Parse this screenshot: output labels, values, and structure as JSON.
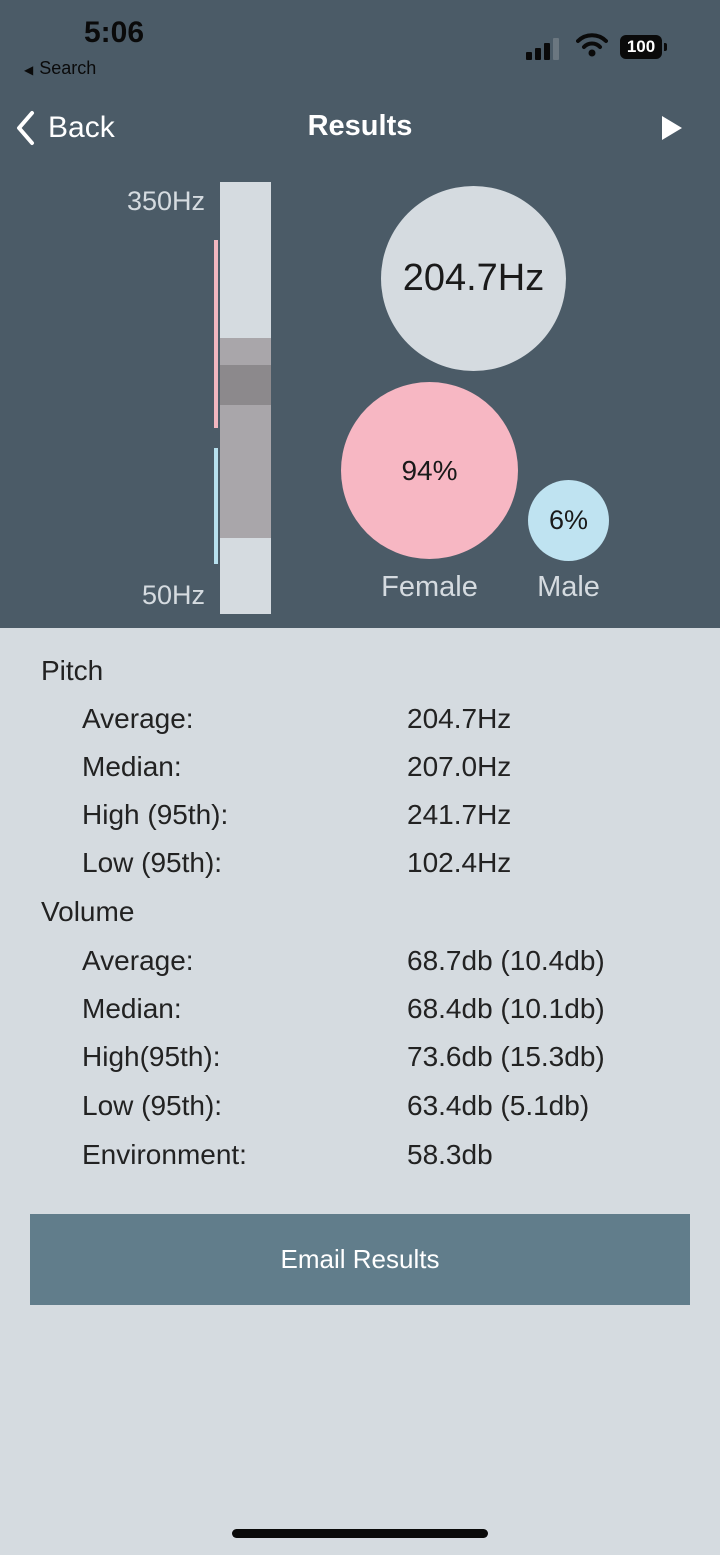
{
  "status_bar": {
    "time": "5:06",
    "back_app": "Search",
    "battery": "100"
  },
  "nav": {
    "back_label": "Back",
    "title": "Results"
  },
  "pitch_scale": {
    "max_label": "350Hz",
    "min_label": "50Hz"
  },
  "summary": {
    "average_pitch": "204.7Hz",
    "female_percent": "94%",
    "male_percent": "6%",
    "female_label": "Female",
    "male_label": "Male"
  },
  "pitch": {
    "heading": "Pitch",
    "rows": [
      {
        "label": "Average:",
        "value": "204.7Hz"
      },
      {
        "label": "Median:",
        "value": "207.0Hz"
      },
      {
        "label": "High (95th):",
        "value": "241.7Hz"
      },
      {
        "label": "Low (95th):",
        "value": "102.4Hz"
      }
    ]
  },
  "volume": {
    "heading": "Volume",
    "rows": [
      {
        "label": "Average:",
        "value": "68.7db (10.4db)"
      },
      {
        "label": "Median:",
        "value": "68.4db (10.1db)"
      },
      {
        "label": "High(95th):",
        "value": "73.6db (15.3db)"
      },
      {
        "label": "Low (95th):",
        "value": "63.4db (5.1db)"
      },
      {
        "label": "Environment:",
        "value": "58.3db"
      }
    ]
  },
  "actions": {
    "email_label": "Email Results"
  },
  "colors": {
    "header_bg": "#4b5b67",
    "page_bg": "#d5dbe0",
    "female": "#f7b7c3",
    "male": "#bfe3f1",
    "button": "#617d8b"
  }
}
